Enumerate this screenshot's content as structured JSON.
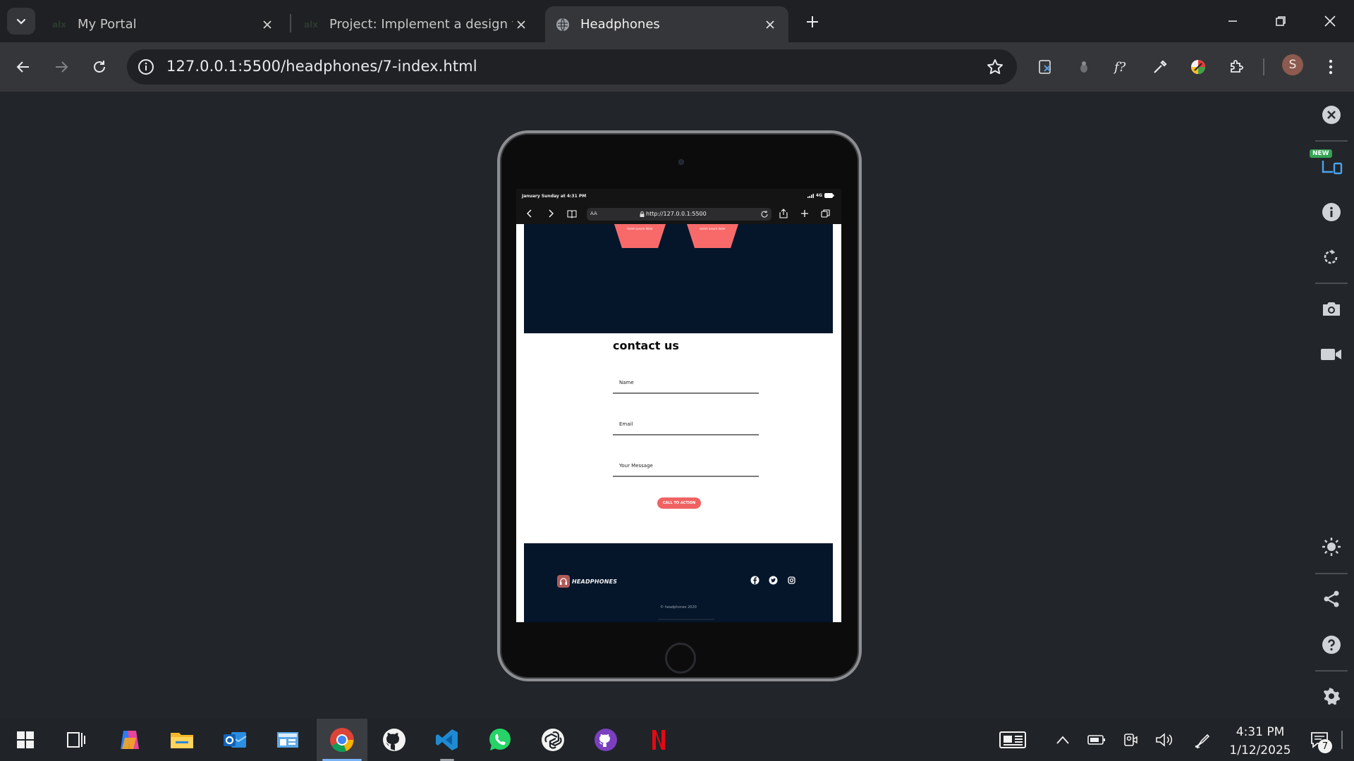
{
  "browser": {
    "tabs": [
      {
        "title": "My Portal",
        "active": false
      },
      {
        "title": "Project: Implement a design fro",
        "active": false
      },
      {
        "title": "Headphones",
        "active": true
      }
    ],
    "url": "127.0.0.1:5500/headphones/7-index.html",
    "profile_initial": "S"
  },
  "device": {
    "status_bar": {
      "time": "January Sunday at 4:31 PM",
      "signal": "4G"
    },
    "safari": {
      "aa_label": "AA",
      "url": "http://127.0.0.1:5500"
    },
    "page": {
      "hero": {
        "cta_left": "lorem ipsum dolor",
        "cta_right": "lorem ipsum dolor",
        "bg_color": "#05162b",
        "accent_color": "#f86a6a"
      },
      "contact": {
        "title": "contact us",
        "name_placeholder": "Name",
        "email_placeholder": "Email",
        "message_placeholder": "Your Message",
        "submit_label": "CALL TO ACTION"
      },
      "footer": {
        "brand": "HEADPHONES",
        "socials": [
          "facebook-icon",
          "twitter-icon",
          "instagram-icon"
        ],
        "copyright": "© headphones 2020"
      }
    }
  },
  "devtools_rail": {
    "new_badge": "NEW",
    "buttons": [
      "close-icon",
      "responsive-icon",
      "info-icon",
      "rotate-icon",
      "camera-icon",
      "video-icon",
      "brightness-icon",
      "share-icon",
      "help-icon",
      "settings-icon"
    ]
  },
  "taskbar": {
    "apps": [
      "windows-start-icon",
      "task-view-icon",
      "copilot-icon",
      "file-explorer-icon",
      "outlook-icon",
      "control-panel-icon",
      "chrome-icon",
      "github-icon",
      "vscode-icon",
      "whatsapp-icon",
      "chatgpt-icon",
      "github-desktop-icon",
      "netflix-icon"
    ],
    "time": "4:31 PM",
    "date": "1/12/2025",
    "notifications": "7"
  }
}
